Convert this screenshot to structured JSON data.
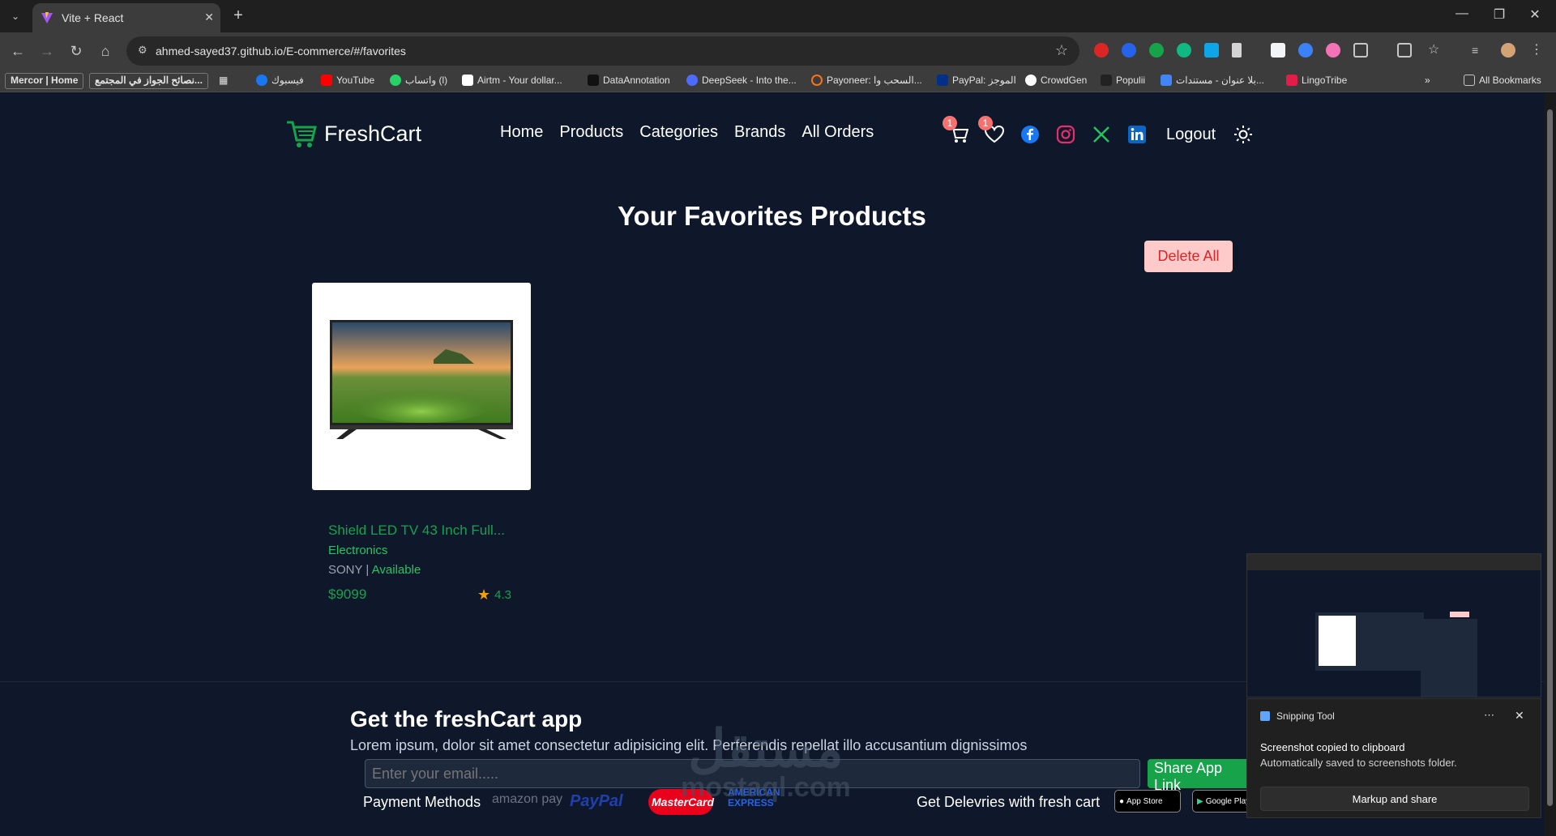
{
  "browser": {
    "tab_title": "Vite + React",
    "url": "ahmed-sayed37.github.io/E-commerce/#/favorites",
    "bookmarks": [
      {
        "label": "Mercor | Home"
      },
      {
        "label": "نصائح الجواز في المجتمع..."
      },
      {
        "label": "فيسبوك"
      },
      {
        "label": "YouTube"
      },
      {
        "label": "واتساب (l)"
      },
      {
        "label": "Airtm - Your dollar..."
      },
      {
        "label": "DataAnnotation"
      },
      {
        "label": "DeepSeek - Into the..."
      },
      {
        "label": "Payoneer: السحب وا..."
      },
      {
        "label": "PayPal: الموجز"
      },
      {
        "label": "CrowdGen"
      },
      {
        "label": "Populii"
      },
      {
        "label": "بلا عنوان - مستندات..."
      },
      {
        "label": "LingoTribe"
      }
    ],
    "all_bookmarks": "All Bookmarks"
  },
  "navbar": {
    "brand": "FreshCart",
    "links": [
      "Home",
      "Products",
      "Categories",
      "Brands",
      "All Orders"
    ],
    "cart_count": "1",
    "wishlist_count": "1",
    "logout": "Logout"
  },
  "main": {
    "title": "Your Favorites Products",
    "delete_all": "Delete All",
    "products": [
      {
        "name": "Shield LED TV 43 Inch Full...",
        "category": "Electronics",
        "brand": "SONY",
        "separator": " | ",
        "availability": "Available",
        "price": "$9099",
        "rating": "4.3"
      }
    ]
  },
  "footer": {
    "title": "Get the freshCart app",
    "text": "Lorem ipsum, dolor sit amet consectetur adipisicing elit. Perferendis repellat illo accusantium dignissimos",
    "email_placeholder": "Enter your email.....",
    "share_button": "Share App Link",
    "payment_label": "Payment Methods",
    "payments": [
      "amazon pay",
      "PayPal",
      "MasterCard",
      "AMERICAN EXPRESS"
    ],
    "delivery_label": "Get Delevries with fresh cart",
    "app_store": "App Store",
    "google_play": "Google Play"
  },
  "watermark": {
    "arabic": "مستقل",
    "latin": "mostaql.com"
  },
  "snipping_tool": {
    "app_name": "Snipping Tool",
    "line1": "Screenshot copied to clipboard",
    "line2": "Automatically saved to screenshots folder.",
    "action": "Markup and share"
  },
  "colors": {
    "accent": "#16a34a",
    "background": "#0f172a",
    "danger_bg": "#fecaca",
    "danger_text": "#dc2626",
    "badge": "#f87171"
  }
}
